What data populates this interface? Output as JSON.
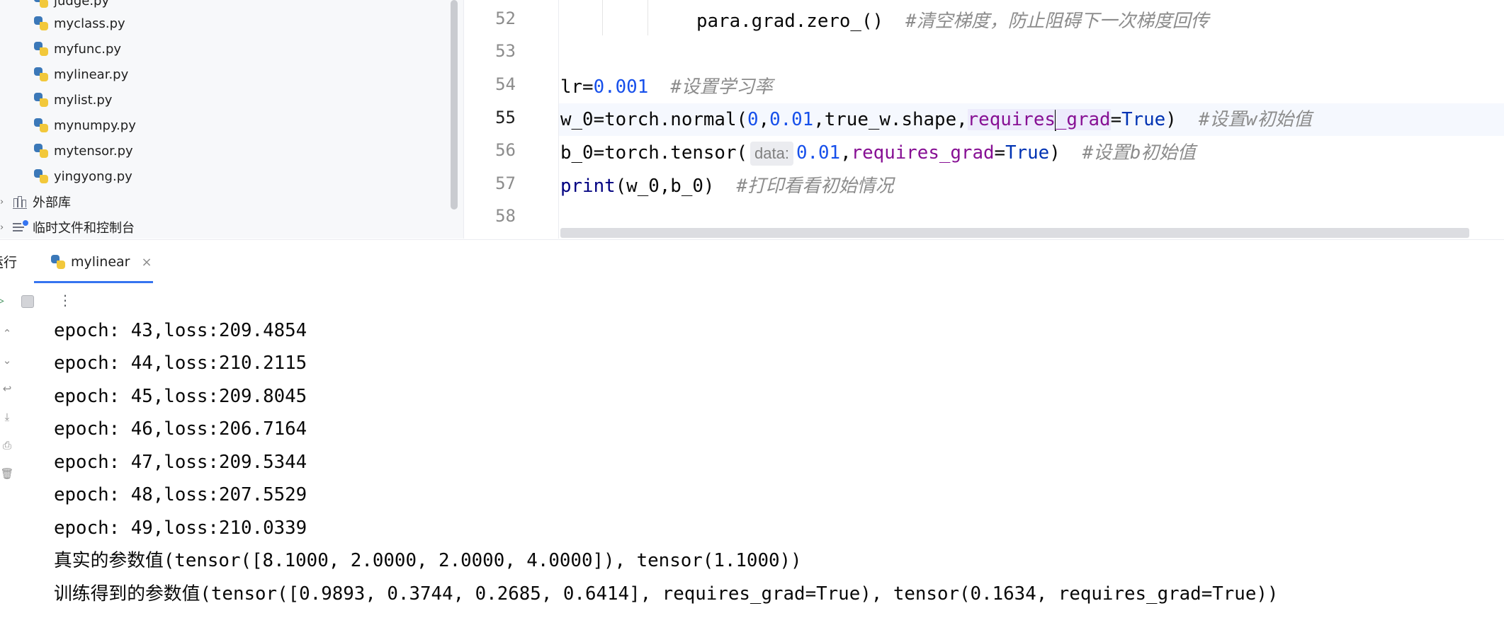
{
  "project_tree": {
    "files": [
      {
        "name": "judge.py"
      },
      {
        "name": "myclass.py"
      },
      {
        "name": "myfunc.py"
      },
      {
        "name": "mylinear.py"
      },
      {
        "name": "mylist.py"
      },
      {
        "name": "mynumpy.py"
      },
      {
        "name": "mytensor.py"
      },
      {
        "name": "yingyong.py"
      }
    ],
    "external_libraries": "外部库",
    "scratches": "临时文件和控制台"
  },
  "editor": {
    "line_numbers": [
      "52",
      "53",
      "54",
      "55",
      "56",
      "57",
      "58"
    ],
    "line52": {
      "code": "para.grad.zero_()",
      "comment": "#清空梯度，防止阻碍下一次梯度回传"
    },
    "line54": {
      "var": "lr=",
      "num": "0.001",
      "comment": "#设置学习率"
    },
    "line55": {
      "pre": "w_0=torch.normal(",
      "n1": "0",
      "comma1": ",",
      "n2": "0.01",
      "mid": ",true_w.shape,",
      "param_a": "requires",
      "param_b": "_grad",
      "eq": "=",
      "kw": "True",
      "close": ")",
      "comment": "#设置w初始值"
    },
    "line56": {
      "pre": "b_0=torch.tensor(",
      "hint": "data:",
      "num": "0.01",
      "comma": ",",
      "param": "requires_grad",
      "eq": "=",
      "kw": "True",
      "close": ")",
      "comment": "#设置b初始值"
    },
    "line57": {
      "fn": "print",
      "args": "(w_0,b_0)",
      "comment": "#打印看看初始情况"
    }
  },
  "run": {
    "label": "运行",
    "tab_label": "mylinear",
    "close_glyph": "×",
    "more_glyph": "⋮",
    "rerun_glyph": "▷"
  },
  "console": {
    "lines": [
      "epoch: 43,loss:209.4854",
      "epoch: 44,loss:210.2115",
      "epoch: 45,loss:209.8045",
      "epoch: 46,loss:206.7164",
      "epoch: 47,loss:209.5344",
      "epoch: 48,loss:207.5529",
      "epoch: 49,loss:210.0339",
      "真实的参数值(tensor([8.1000, 2.0000, 2.0000, 4.0000]), tensor(1.1000))",
      "训练得到的参数值(tensor([0.9893, 0.3744, 0.2685, 0.6414], requires_grad=True), tensor(0.1634, requires_grad=True))"
    ]
  },
  "colors": {
    "accent": "#3574f0",
    "number": "#1750eb",
    "keyword": "#0033b3",
    "parameter": "#871094",
    "comment": "#8c8c8c"
  },
  "icons": [
    "python-file-icon",
    "library-icon",
    "scratches-icon",
    "rerun-icon",
    "stop-icon",
    "more-icon",
    "close-icon"
  ]
}
